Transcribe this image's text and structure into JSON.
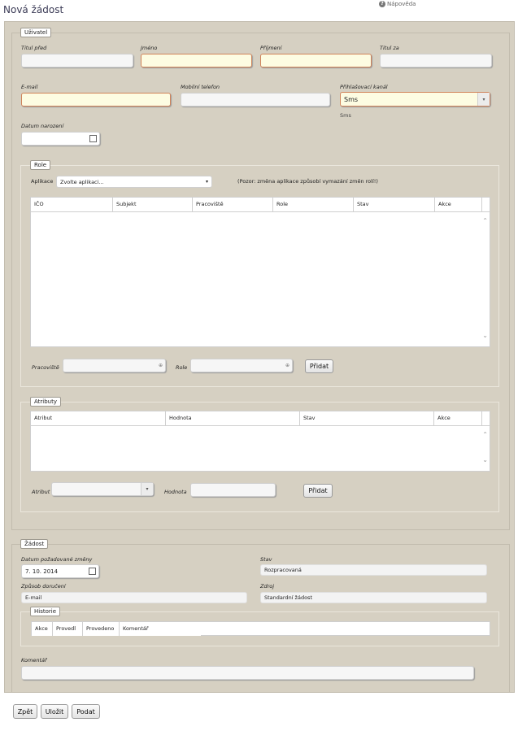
{
  "page": {
    "title": "Nová žádost",
    "help": "Nápověda"
  },
  "user": {
    "legend": "Uživatel",
    "title_before_label": "Titul před",
    "first_name_label": "Jméno",
    "last_name_label": "Příjmení",
    "title_after_label": "Titul za",
    "email_label": "E-mail",
    "mobile_label": "Mobilní telefon",
    "login_channel_label": "Přihlašovací kanál",
    "login_channel_value": "Sms",
    "login_channel_note": "Sms",
    "birth_date_label": "Datum narození"
  },
  "roles": {
    "legend": "Role",
    "app_label": "Aplikace",
    "app_placeholder": "Zvolte aplikaci...",
    "app_warning": "(Pozor: změna aplikace způsobí vymazání změn rolí!)",
    "columns": [
      "IČO",
      "Subjekt",
      "Pracoviště",
      "Role",
      "Stav",
      "Akce"
    ],
    "workplace_label": "Pracoviště",
    "role_label": "Role",
    "add_button": "Přidat"
  },
  "attributes": {
    "legend": "Atributy",
    "columns": [
      "Atribut",
      "Hodnota",
      "Stav",
      "Akce"
    ],
    "attr_label": "Atribut",
    "value_label": "Hodnota",
    "add_button": "Přidat"
  },
  "request": {
    "legend": "Žádost",
    "change_date_label": "Datum požadované změny",
    "change_date_value": "7. 10. 2014",
    "state_label": "Stav",
    "state_value": "Rozpracovaná",
    "delivery_label": "Způsob doručení",
    "delivery_value": "E-mail",
    "source_label": "Zdroj",
    "source_value": "Standardní žádost",
    "history_legend": "Historie",
    "history_columns": [
      "Akce",
      "Provedl",
      "Provedeno",
      "Komentář"
    ],
    "comment_label": "Komentář"
  },
  "footer": {
    "back": "Zpět",
    "save": "Uložit",
    "submit": "Podat"
  },
  "colors": {
    "panel": "#d6d0c2",
    "required_bg": "#fdfce2",
    "required_border": "#d0835a"
  }
}
